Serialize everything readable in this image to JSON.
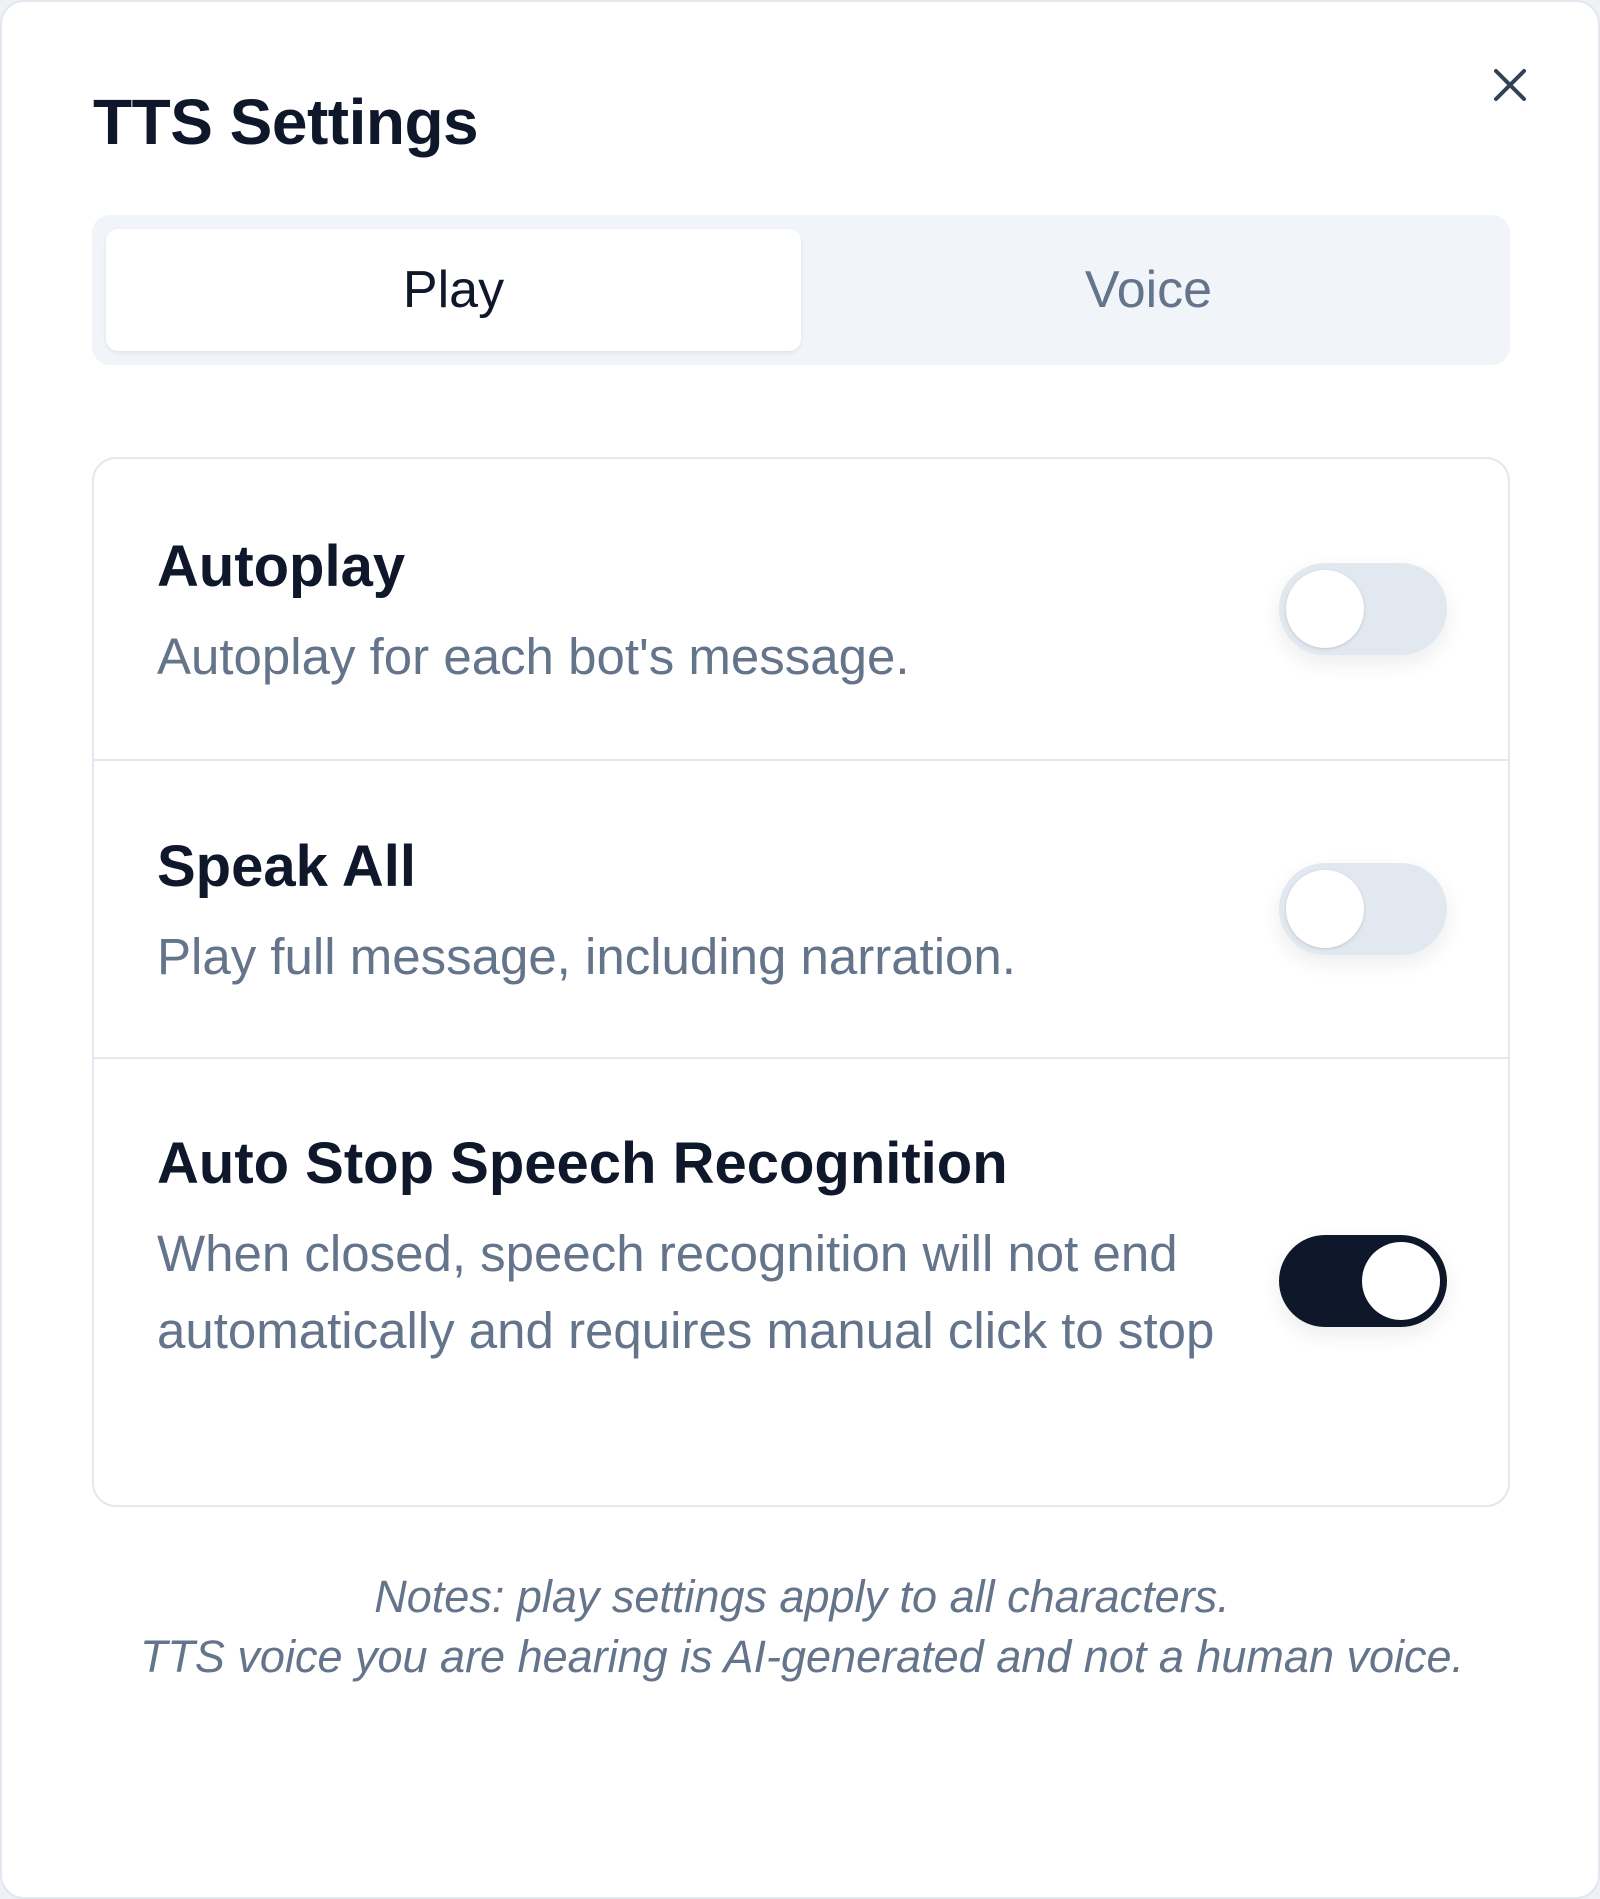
{
  "dialog": {
    "title": "TTS Settings",
    "close_icon": "close-icon"
  },
  "tabs": [
    {
      "label": "Play",
      "active": true
    },
    {
      "label": "Voice",
      "active": false
    }
  ],
  "settings": [
    {
      "title": "Autoplay",
      "description": "Autoplay for each bot's message.",
      "enabled": false
    },
    {
      "title": "Speak All",
      "description": "Play full message, including narration.",
      "enabled": false
    },
    {
      "title": "Auto Stop Speech Recognition",
      "description": "When closed, speech recognition will not end automatically and requires manual click to stop",
      "enabled": true
    }
  ],
  "notes": {
    "line1": "Notes: play settings apply to all characters.",
    "line2": "TTS voice you are hearing is AI-generated and not a human voice."
  },
  "colors": {
    "toggle_on": "#0f172a",
    "toggle_off": "#e2e8f0",
    "muted_text": "#64748b",
    "primary_text": "#0f172a"
  }
}
